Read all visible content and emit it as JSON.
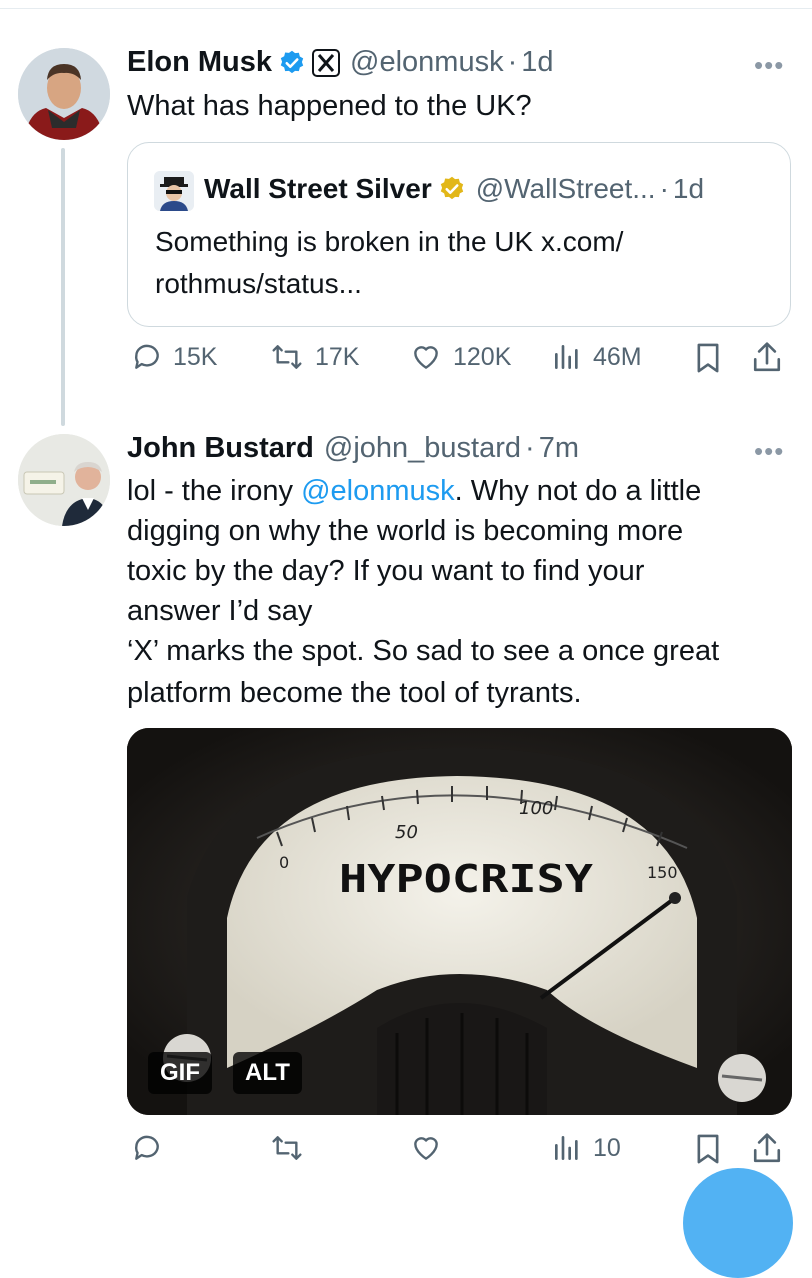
{
  "tweets": [
    {
      "name": "Elon Musk",
      "handle": "@elonmusk",
      "time": "1d",
      "text": "What has happened to the UK?",
      "quote": {
        "name": "Wall Street Silver",
        "handle": "@WallStreet...",
        "time": "1d",
        "text_line1": "Something is broken in the UK x.com/",
        "text_line2": "rothmus/status..."
      },
      "actions": {
        "replies": "15K",
        "reposts": "17K",
        "likes": "120K",
        "views": "46M"
      }
    },
    {
      "name": "John Bustard",
      "handle": "@john_bustard",
      "time": "7m",
      "text_line1_prefix": "lol - the irony ",
      "text_line1_mention": "@elonmusk",
      "text_line1_suffix": ".  Why not do a little",
      "text_line2": "digging on why the world is becoming more",
      "text_line3": "toxic by the day?  If you want to find your",
      "text_line4": "answer I’d say",
      "text_line5": "‘X’ marks the spot.  So sad to see a once great",
      "text_line6": "platform become the tool of tyrants.",
      "media": {
        "gauge_text": "HYPOCRISY",
        "gauge_50": "50",
        "gauge_100": "100",
        "gauge_0": "0",
        "gauge_150": "150",
        "gif_label": "GIF",
        "alt_label": "ALT"
      },
      "actions": {
        "views": "10"
      }
    }
  ],
  "dot": "·",
  "more": "•••",
  "colors": {
    "accent": "#1d9bf0",
    "verified_gold": "#e2b719",
    "muted": "#536471"
  }
}
